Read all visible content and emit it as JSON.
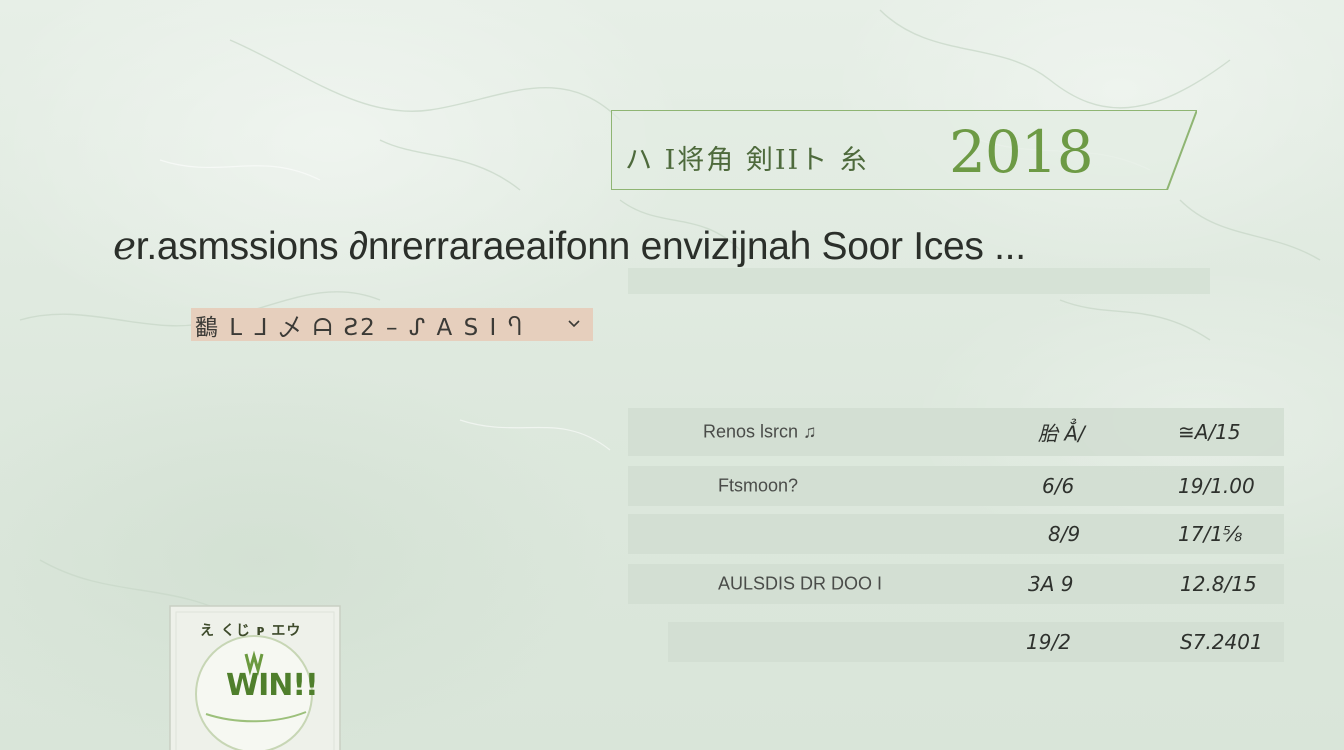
{
  "banner": {
    "label": "ハ I将角 剣IIト 糸",
    "year": "2018",
    "accent": "#6d9a45"
  },
  "headline": {
    "text": "ℯr.asmssions ∂nrerraraeaifonn envizijnah Soor Ices ..."
  },
  "subtag": {
    "text": "鷭 ᒪ ᒧ 乄 ᗩ Ƨ2 – ᔑ A S I Ⴄ",
    "chevron_icon": "chevron-down-icon",
    "background": "#e6cfbd"
  },
  "table": {
    "rows": [
      {
        "label": "Renos lsrcn ♫",
        "col1": "胎 Ẳ/",
        "col2": "≅A/15"
      },
      {
        "label": "Ftsmoon?",
        "col1": "6/6",
        "col2": "19/1.00"
      },
      {
        "label": "",
        "col1": "8/9",
        "col2": "17/1⅝"
      },
      {
        "label": "AULSDIS DR DOO I",
        "col1": "3A 9",
        "col2": "12.8/15"
      },
      {
        "label": "",
        "col1": "19/2",
        "col2": "S7.2401"
      }
    ]
  },
  "package": {
    "line1": "え くじ ᴩ エウ",
    "logo": "WIN!!",
    "icon": "package-logo-icon"
  }
}
